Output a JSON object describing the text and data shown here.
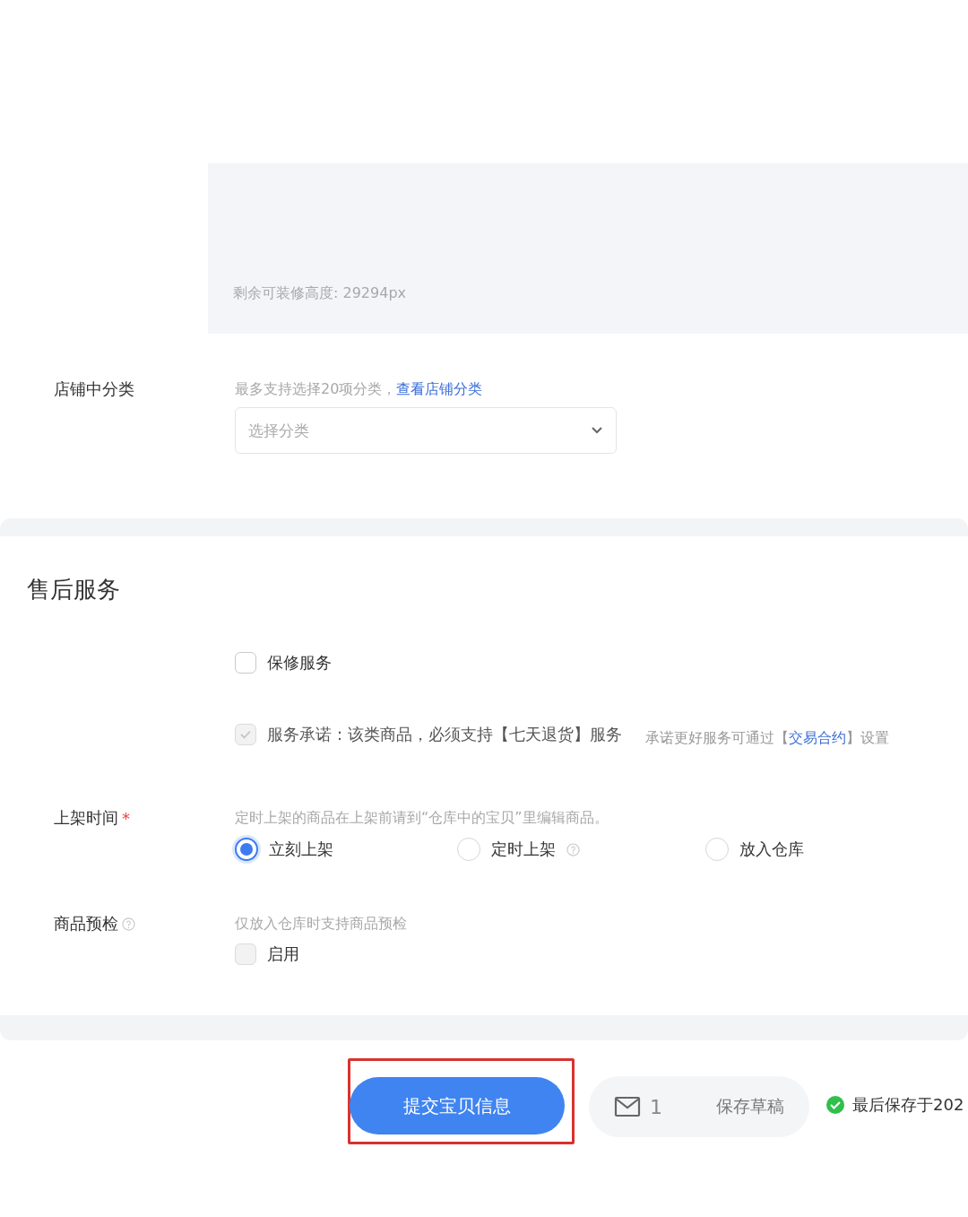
{
  "editor": {
    "remaining_height": "剩余可装修高度: 29294px"
  },
  "shop_category": {
    "label": "店铺中分类",
    "hint": "最多支持选择20项分类，",
    "link": "查看店铺分类",
    "select": {
      "placeholder": "选择分类"
    }
  },
  "after_sales": {
    "title": "售后服务",
    "options": [
      {
        "label": "保修服务",
        "checked": false,
        "disabled": false
      },
      {
        "label": "服务承诺：该类商品，必须支持【七天退货】服务",
        "checked": true,
        "disabled": true,
        "note": {
          "before": "承诺更好服务可通过【",
          "link": "交易合约",
          "after": "】设置"
        }
      }
    ]
  },
  "listing_time": {
    "label": "上架时间",
    "required_mark": "*",
    "hint": "定时上架的商品在上架前请到“仓库中的宝贝”里编辑商品。",
    "options": [
      {
        "label": "立刻上架",
        "selected": true,
        "help": false
      },
      {
        "label": "定时上架",
        "selected": false,
        "help": true
      },
      {
        "label": "放入仓库",
        "selected": false,
        "help": false
      }
    ]
  },
  "precheck": {
    "label": "商品预检",
    "help": true,
    "hint": "仅放入仓库时支持商品预检",
    "option": {
      "label": "启用",
      "checked": false,
      "disabled": true
    }
  },
  "footer": {
    "submit": {
      "label": "提交宝贝信息",
      "highlighted": true
    },
    "drafts": {
      "count": "1",
      "label": "保存草稿"
    },
    "status": {
      "text": "最后保存于202",
      "ok": true
    }
  }
}
